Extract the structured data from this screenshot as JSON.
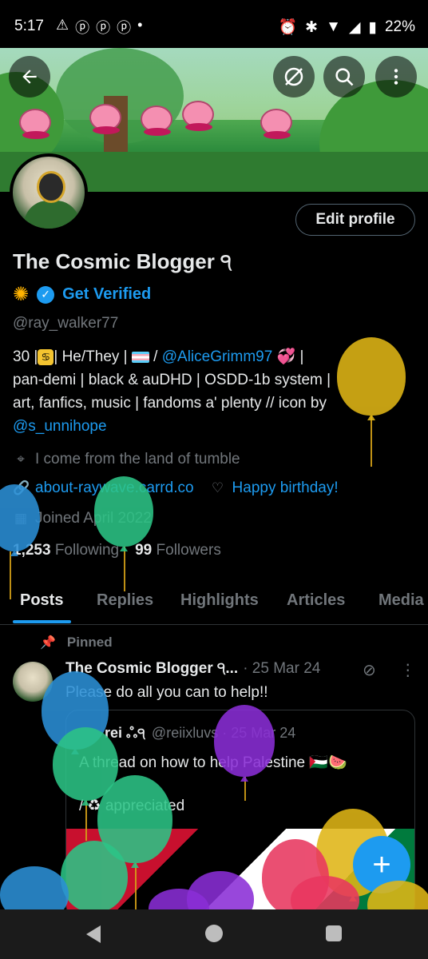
{
  "status_bar": {
    "time": "5:17",
    "battery": "22%"
  },
  "header": {
    "back_label": "Back",
    "search_label": "Search",
    "more_label": "More"
  },
  "profile": {
    "edit_button": "Edit profile",
    "display_name": "The Cosmic Blogger ੧",
    "get_verified": "Get Verified",
    "handle": "@ray_walker77",
    "bio": {
      "line1_prefix": "30 |",
      "line1_mid": "| He/They |",
      "line1_slash": " / ",
      "line1_mention": "@AliceGrimm97",
      "line1_suffix": " 💞 |",
      "line2": "pan-demi | black & auDHD | OSDD-1b system |",
      "line3": "art, fanfics, music | fandoms a' plenty // icon by",
      "line4_mention": "@s_unnihope"
    },
    "location": "I come from the land of tumble",
    "website": "about-raywave.carrd.co",
    "birthday": "Happy birthday!",
    "joined": "Joined April 2022",
    "following_count": "1,253",
    "following_label": "Following",
    "followers_count": "99",
    "followers_label": "Followers"
  },
  "tabs": [
    "Posts",
    "Replies",
    "Highlights",
    "Articles",
    "Media"
  ],
  "pinned_post": {
    "pinned_label": "Pinned",
    "author": "The Cosmic Blogger ੧...",
    "date": "· 25 Mar 24",
    "text": "Please do all you can to help!!",
    "quote": {
      "name": "rei ஃ੧",
      "meta": "@reiixluvs · 25 Mar 24",
      "text": "A thread on how to help Palestine 🇵🇸🍉",
      "text2": "/ ♻ appreciated"
    }
  },
  "fab_label": "+",
  "colors": {
    "accent": "#1d9bf0",
    "background": "#000000",
    "muted": "#71767b"
  }
}
